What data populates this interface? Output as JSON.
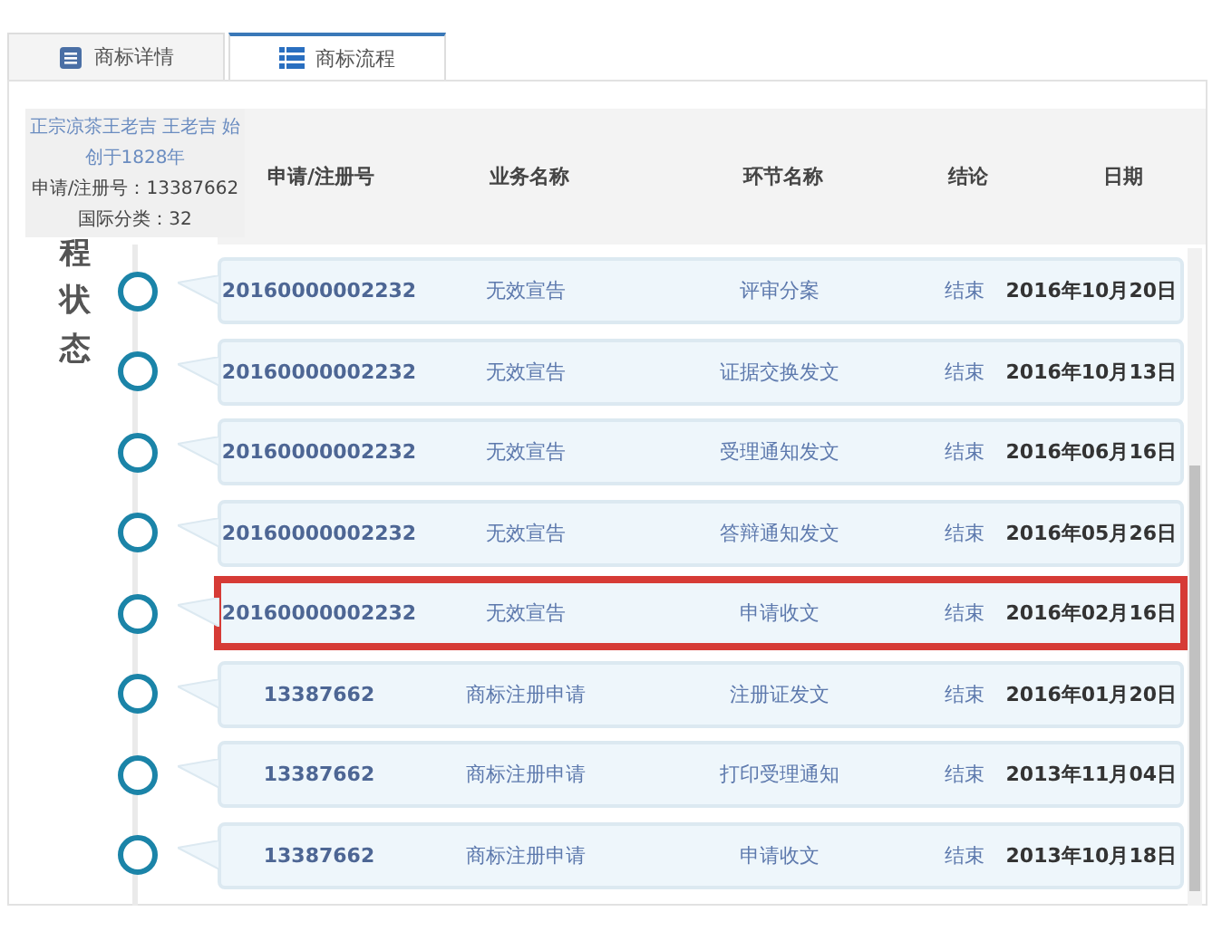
{
  "tabs": [
    {
      "label": "商标详情",
      "kind": "detail",
      "selected": false
    },
    {
      "label": "商标流程",
      "kind": "flow",
      "selected": true
    }
  ],
  "tooltip": {
    "title": "正宗凉茶王老吉 王老吉 始创于1828年",
    "lines": [
      "申请/注册号：13387662",
      "国际分类：32"
    ]
  },
  "side_label": "程状态",
  "table": {
    "columns": [
      "申请/注册号",
      "业务名称",
      "环节名称",
      "结论",
      "日期"
    ],
    "rows": [
      {
        "number": "20160000002232",
        "business": "无效宣告",
        "step": "评审分案",
        "result": "结束",
        "date": "2016年10月20日",
        "selected": false
      },
      {
        "number": "20160000002232",
        "business": "无效宣告",
        "step": "证据交换发文",
        "result": "结束",
        "date": "2016年10月13日",
        "selected": false
      },
      {
        "number": "20160000002232",
        "business": "无效宣告",
        "step": "受理通知发文",
        "result": "结束",
        "date": "2016年06月16日",
        "selected": false
      },
      {
        "number": "20160000002232",
        "business": "无效宣告",
        "step": "答辩通知发文",
        "result": "结束",
        "date": "2016年05月26日",
        "selected": false
      },
      {
        "number": "20160000002232",
        "business": "无效宣告",
        "step": "申请收文",
        "result": "结束",
        "date": "2016年02月16日",
        "selected": true
      },
      {
        "number": "13387662",
        "business": "商标注册申请",
        "step": "注册证发文",
        "result": "结束",
        "date": "2016年01月20日",
        "selected": false
      },
      {
        "number": "13387662",
        "business": "商标注册申请",
        "step": "打印受理通知",
        "result": "结束",
        "date": "2013年11月04日",
        "selected": false
      },
      {
        "number": "13387662",
        "business": "商标注册申请",
        "step": "申请收文",
        "result": "结束",
        "date": "2013年10月18日",
        "selected": false
      }
    ]
  }
}
